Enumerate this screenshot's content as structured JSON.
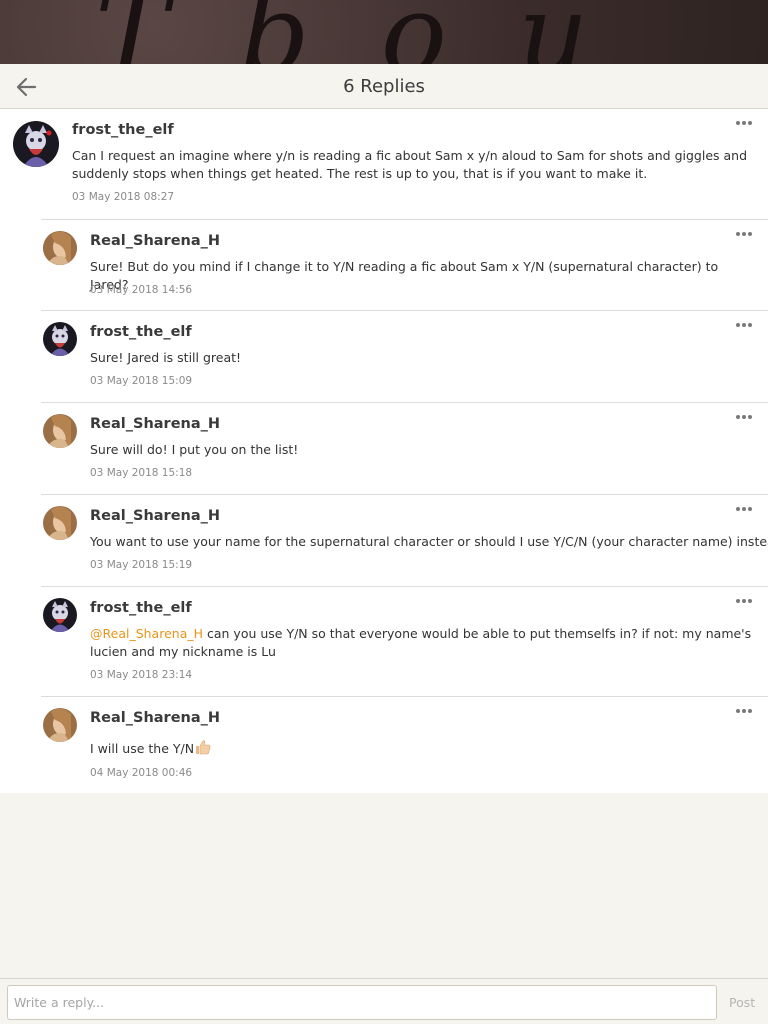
{
  "header": {
    "title": "6 Replies",
    "back_icon": "arrow-left-icon"
  },
  "comments": [
    {
      "username": "frost_the_elf",
      "text": "Can I request an imagine where y/n is reading a fic about Sam x y/n aloud to Sam for shots and giggles and suddenly stops when things get heated. The rest is up to you, that is if you want to make it.",
      "timestamp": "03 May 2018 08:27"
    },
    {
      "username": "Real_Sharena_H",
      "text": "Sure! But do you mind if I change it to Y/N reading a fic about Sam x Y/N (supernatural character) to Jared?",
      "timestamp": "03 May 2018 14:56"
    },
    {
      "username": "frost_the_elf",
      "text": "Sure! Jared is still great!",
      "timestamp": "03 May 2018 15:09"
    },
    {
      "username": "Real_Sharena_H",
      "text": "Sure will do! I put you on the list!",
      "timestamp": "03 May 2018 15:18"
    },
    {
      "username": "Real_Sharena_H",
      "text": "You want to use your name for the supernatural character or should I use Y/C/N (your character name) instead?",
      "timestamp": "03 May 2018 15:19"
    },
    {
      "username": "frost_the_elf",
      "mention": "@Real_Sharena_H",
      "text": " can you use Y/N so that everyone would be able to put themselfs in? if not: my name's lucien and my nickname is Lu",
      "timestamp": "03 May 2018 23:14"
    },
    {
      "username": "Real_Sharena_H",
      "text": "I will use the Y/N",
      "emoji": "thumbs-up-icon",
      "timestamp": "04 May 2018 00:46"
    }
  ],
  "reply_bar": {
    "placeholder": "Write a reply...",
    "post_label": "Post"
  },
  "colors": {
    "mention": "#e8941c",
    "background": "#f6f4ef",
    "list_background": "#ffffff"
  }
}
